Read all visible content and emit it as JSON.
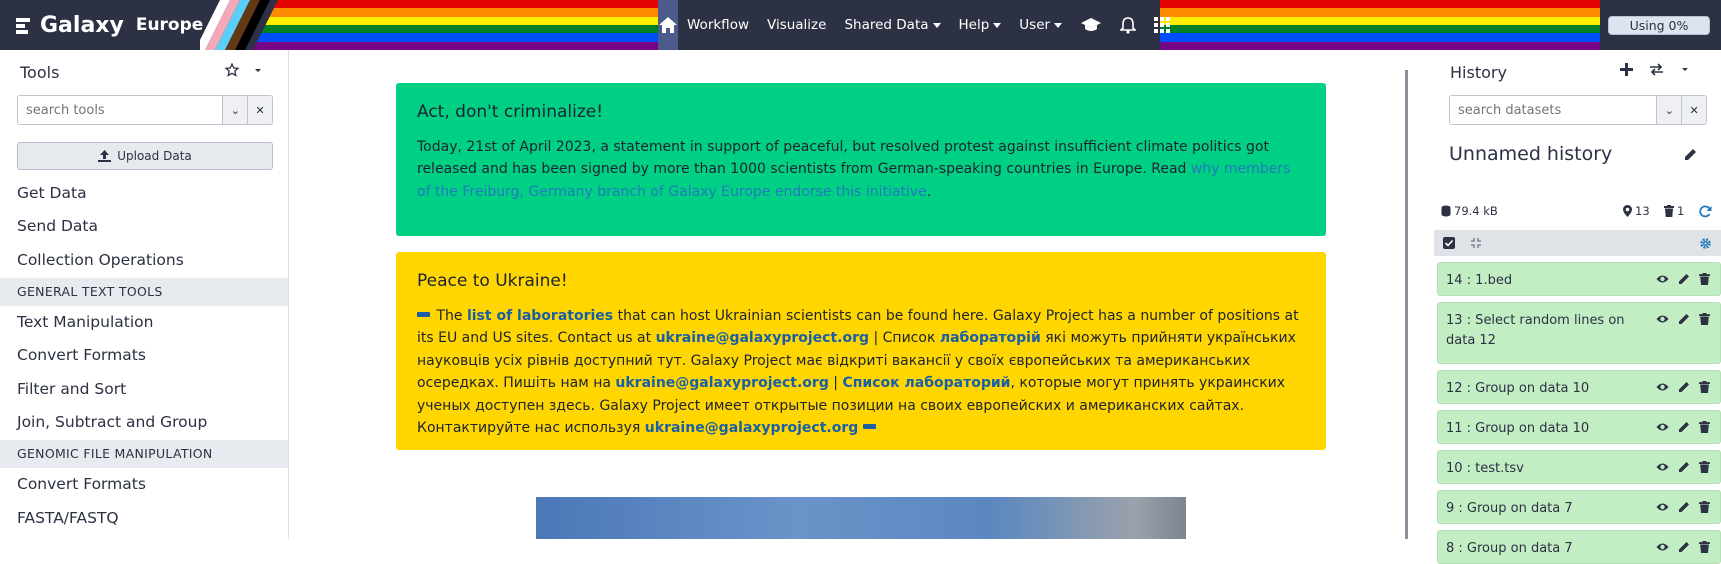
{
  "masthead": {
    "brand": "Galaxy",
    "subtitle": "Europe",
    "nav": {
      "workflow": "Workflow",
      "visualize": "Visualize",
      "shared_data": "Shared Data",
      "help": "Help",
      "user": "User"
    },
    "quota": "Using 0%",
    "rainbow_colors": [
      "#e40303",
      "#ff8c00",
      "#ffed00",
      "#008026",
      "#004dff",
      "#750787"
    ]
  },
  "tools": {
    "title": "Tools",
    "search_placeholder": "search tools",
    "upload_label": "Upload Data",
    "items": [
      {
        "kind": "tool",
        "label": "Get Data"
      },
      {
        "kind": "tool",
        "label": "Send Data"
      },
      {
        "kind": "tool",
        "label": "Collection Operations"
      },
      {
        "kind": "section",
        "label": "GENERAL TEXT TOOLS"
      },
      {
        "kind": "tool",
        "label": "Text Manipulation"
      },
      {
        "kind": "tool",
        "label": "Convert Formats"
      },
      {
        "kind": "tool",
        "label": "Filter and Sort"
      },
      {
        "kind": "tool",
        "label": "Join, Subtract and Group"
      },
      {
        "kind": "section",
        "label": "GENOMIC FILE MANIPULATION"
      },
      {
        "kind": "tool",
        "label": "Convert Formats"
      },
      {
        "kind": "tool",
        "label": "FASTA/FASTQ"
      }
    ]
  },
  "center": {
    "green_alert": {
      "title": "Act, don't criminalize!",
      "text": "Today, 21st of April 2023, a statement in support of peaceful, but resolved protest against insufficient climate politics got released and has been signed by more than 1000 scientists from German-speaking countries in Europe. Read ",
      "link": "why members of the Freiburg, Germany branch of Galaxy Europe endorse this initiative",
      "end": "."
    },
    "yellow_alert": {
      "title": "Peace to Ukraine!",
      "p1": " The ",
      "link1": "list of laboratories",
      "p2": " that can host Ukrainian scientists can be found here. Galaxy Project has a number of positions at its EU and US sites. Contact us at ",
      "email1": "ukraine@galaxyproject.org",
      "p3": " | Список ",
      "link2": "лабораторій",
      "p4": " які можуть прийняти українських науковців усіх рівнів доступний тут. Galaxy Project має відкриті вакансії у своїх європейських та американських осередках. Пишіть нам на ",
      "email2": "ukraine@galaxyproject.org",
      "p5": " | ",
      "link3": "Список лабораторий",
      "p6": ", которые могут принять украинских ученых доступен здесь. Galaxy Project имеет открытые позиции на своих европейских и американских сайтах. Контактируйте нас используя ",
      "email3": "ukraine@galaxyproject.org"
    }
  },
  "history": {
    "title": "History",
    "search_placeholder": "search datasets",
    "name": "Unnamed history",
    "size": "79.4 kB",
    "shown_count": "13",
    "deleted_count": "1",
    "datasets": [
      {
        "label": "14 : 1.bed"
      },
      {
        "label": "13 : Select random lines on data 12"
      },
      {
        "label": "12 : Group on data 10"
      },
      {
        "label": "11 : Group on data 10"
      },
      {
        "label": "10 : test.tsv"
      },
      {
        "label": "9 : Group on data 7"
      },
      {
        "label": "8 : Group on data 7"
      }
    ]
  }
}
